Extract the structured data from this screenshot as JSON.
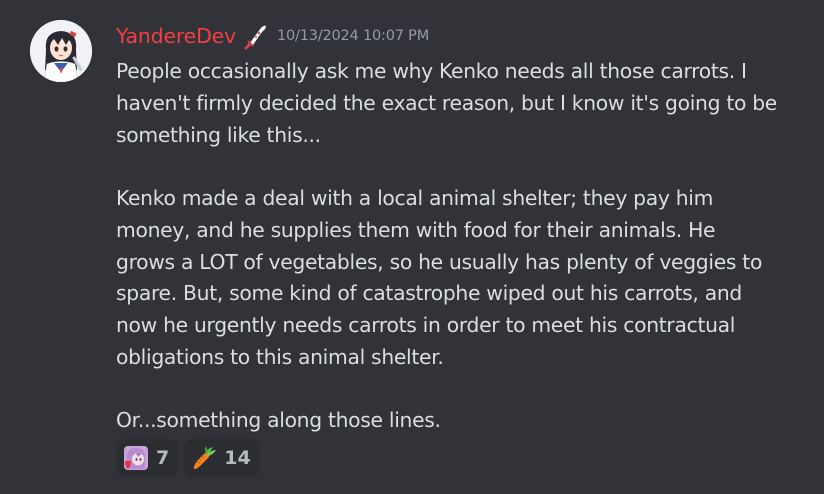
{
  "message": {
    "author": "YandereDev",
    "author_color": "#f23f43",
    "role_icon": "knife-icon",
    "timestamp": "10/13/2024 10:07 PM",
    "lines": [
      "People occasionally ask me why Kenko needs all those carrots. I",
      "haven't firmly decided the exact reason, but I know it's going to be",
      "something like this...",
      "",
      "Kenko made a deal with a local animal shelter; they pay him",
      "money, and he supplies them with food for their animals. He",
      "grows a LOT of vegetables, so he usually has plenty of veggies to",
      "spare. But, some kind of catastrophe wiped out his carrots, and",
      "now he urgently needs carrots in order to meet his contractual",
      "obligations to this animal shelter.",
      "",
      "Or...something along those lines."
    ]
  },
  "reactions": [
    {
      "emoji": "anime-girl-heart-emoji",
      "count": "7"
    },
    {
      "emoji": "carrot-emoji",
      "count": "14"
    }
  ],
  "colors": {
    "background": "#313338",
    "text": "#dbdee1",
    "timestamp": "#949ba4",
    "reaction_bg": "#2b2d31"
  }
}
